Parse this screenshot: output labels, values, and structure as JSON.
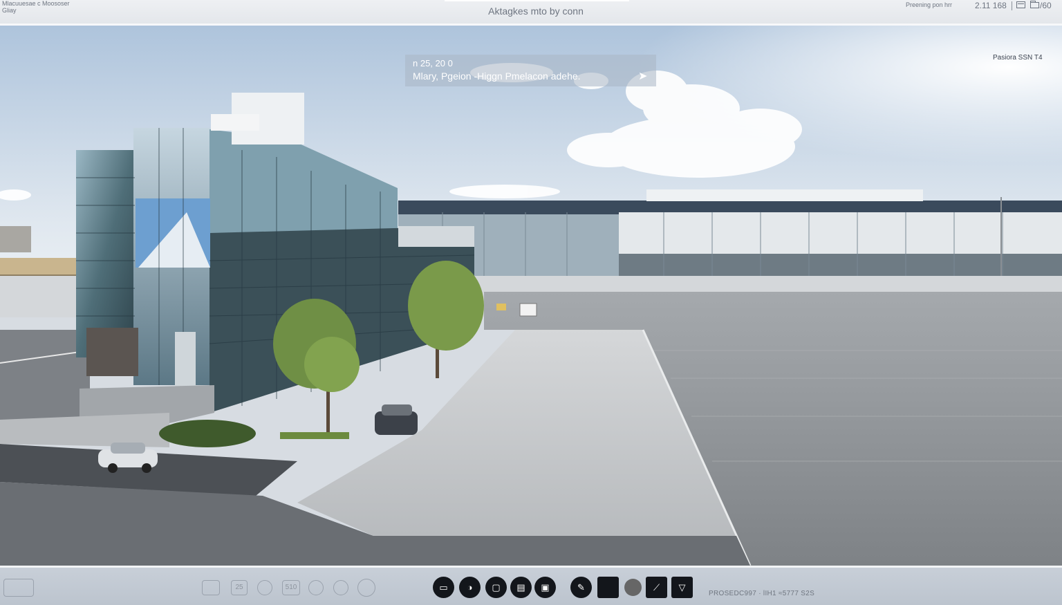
{
  "topbar": {
    "left_line1": "Mlacuuesae c Moososer",
    "left_line2": "Gliay",
    "title": "Aktagkes mto by conn",
    "right_text": "Preening pon hrr",
    "right_count": "2.11 168",
    "right_label": "/60"
  },
  "overlay": {
    "time": "n 25, 20 0",
    "caption": "Mlary, Pgeion  -Higgn Pmelacon adehe.",
    "arrow_icon": "arrow-right-icon",
    "top_right_label": "Pasiora SSN T4"
  },
  "toolbar": {
    "ghost_buttons": [
      "",
      "25",
      "",
      "510",
      "",
      "",
      ""
    ],
    "tools": [
      {
        "icon": "screen-icon",
        "glyph": "▭"
      },
      {
        "icon": "color-wheel-icon",
        "glyph": "◑"
      },
      {
        "icon": "frame-icon",
        "glyph": "▢"
      },
      {
        "icon": "chat-icon",
        "glyph": "▤"
      },
      {
        "icon": "gallery-icon",
        "glyph": "▣"
      },
      {
        "icon": "pen-icon",
        "glyph": "✎"
      },
      {
        "icon": "square-icon",
        "glyph": ""
      },
      {
        "icon": "record-icon",
        "glyph": ""
      },
      {
        "icon": "draw-icon",
        "glyph": "⟋"
      },
      {
        "icon": "triangle-icon",
        "glyph": "▽"
      }
    ],
    "status_text": "PROSEDC997 ·  lIH1  ≈5777  S2S"
  },
  "colors": {
    "sky_top": "#aec4dc",
    "glass": "#5f7f88",
    "plaza": "#b9bcbf",
    "lot": "#8b8e91"
  }
}
